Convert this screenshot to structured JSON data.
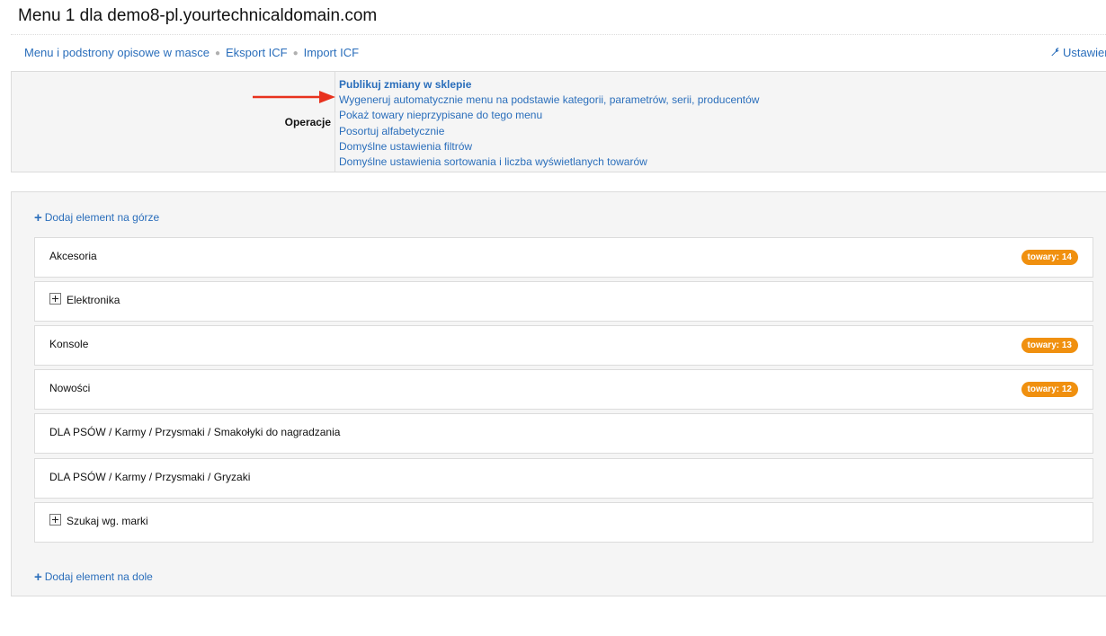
{
  "page": {
    "title": "Menu 1 dla demo8-pl.yourtechnicaldomain.com"
  },
  "subnav": {
    "links": [
      "Menu i podstrony opisowe w masce",
      "Eksport ICF",
      "Import ICF"
    ],
    "settings_label": "Ustawienia",
    "settings_icon": "wrench-icon"
  },
  "operations": {
    "label": "Operacje",
    "arrow_color": "#e8321e",
    "links": [
      "Publikuj zmiany w sklepie",
      "Wygeneruj automatycznie menu na podstawie kategorii, parametrów, serii, producentów",
      "Pokaż towary nieprzypisane do tego menu",
      "Posortuj alfabetycznie",
      "Domyślne ustawienia filtrów",
      "Domyślne ustawienia sortowania i liczba wyświetlanych towarów"
    ]
  },
  "tree": {
    "add_top": "Dodaj element na górze",
    "add_bottom": "Dodaj element na dole",
    "badge_color": "#f0900f",
    "items": [
      {
        "label": "Akcesoria",
        "expandable": false,
        "badge": "towary: 14"
      },
      {
        "label": "Elektronika",
        "expandable": true,
        "badge": ""
      },
      {
        "label": "Konsole",
        "expandable": false,
        "badge": "towary: 13"
      },
      {
        "label": "Nowości",
        "expandable": false,
        "badge": "towary: 12"
      },
      {
        "label": "DLA PSÓW / Karmy / Przysmaki / Smakołyki do nagradzania",
        "expandable": false,
        "badge": ""
      },
      {
        "label": "DLA PSÓW / Karmy / Przysmaki / Gryzaki",
        "expandable": false,
        "badge": ""
      },
      {
        "label": "Szukaj wg. marki",
        "expandable": true,
        "badge": ""
      }
    ]
  }
}
